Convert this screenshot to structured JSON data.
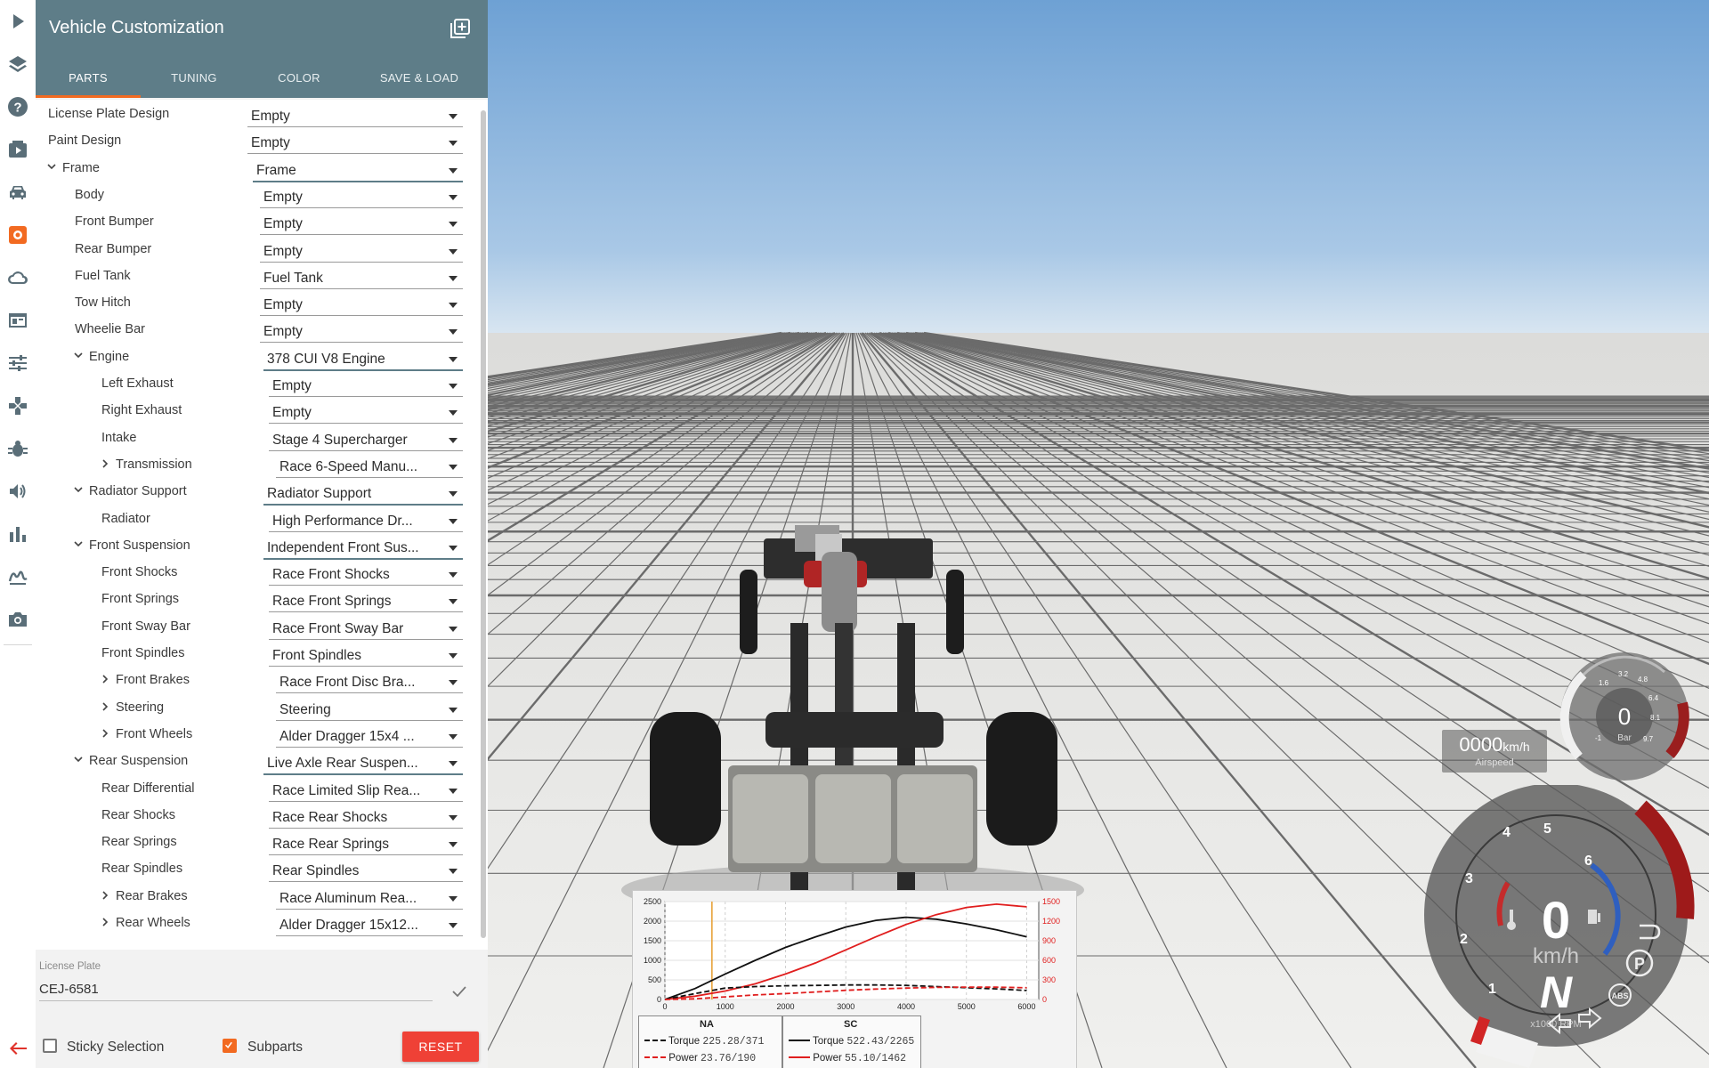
{
  "sidebar": {
    "icons": [
      "play-icon",
      "layers-icon",
      "help-icon",
      "video-icon",
      "car-icon",
      "gear-icon",
      "cloud-icon",
      "window-icon",
      "sliders-icon",
      "gamepad-icon",
      "bug-icon",
      "sound-icon",
      "stats-icon",
      "signature-icon",
      "camera-icon",
      "back-arrow-icon"
    ],
    "active": "gear-icon"
  },
  "panel": {
    "title": "Vehicle Customization",
    "tabs": [
      "PARTS",
      "TUNING",
      "COLOR",
      "SAVE & LOAD"
    ],
    "active_tab": "PARTS"
  },
  "parts": [
    {
      "label": "License Plate Design",
      "value": "Empty",
      "level": 0,
      "chev": ""
    },
    {
      "label": "Paint Design",
      "value": "Empty",
      "level": 0,
      "chev": ""
    },
    {
      "label": "Frame",
      "value": "Frame",
      "level": 0,
      "chev": "down",
      "group": true
    },
    {
      "label": "Body",
      "value": "Empty",
      "level": 1,
      "chev": ""
    },
    {
      "label": "Front Bumper",
      "value": "Empty",
      "level": 1,
      "chev": ""
    },
    {
      "label": "Rear Bumper",
      "value": "Empty",
      "level": 1,
      "chev": ""
    },
    {
      "label": "Fuel Tank",
      "value": "Fuel Tank",
      "level": 1,
      "chev": ""
    },
    {
      "label": "Tow Hitch",
      "value": "Empty",
      "level": 1,
      "chev": ""
    },
    {
      "label": "Wheelie Bar",
      "value": "Empty",
      "level": 1,
      "chev": ""
    },
    {
      "label": "Engine",
      "value": "378 CUI V8 Engine",
      "level": 1,
      "chev": "down",
      "group": true
    },
    {
      "label": "Left Exhaust",
      "value": "Empty",
      "level": 2,
      "chev": ""
    },
    {
      "label": "Right Exhaust",
      "value": "Empty",
      "level": 2,
      "chev": ""
    },
    {
      "label": "Intake",
      "value": "Stage 4 Supercharger",
      "level": 2,
      "chev": ""
    },
    {
      "label": "Transmission",
      "value": "Race 6-Speed Manu...",
      "level": 2,
      "chev": "right"
    },
    {
      "label": "Radiator Support",
      "value": "Radiator Support",
      "level": 1,
      "chev": "down",
      "group": true
    },
    {
      "label": "Radiator",
      "value": "High Performance Dr...",
      "level": 2,
      "chev": ""
    },
    {
      "label": "Front Suspension",
      "value": "Independent Front Sus...",
      "level": 1,
      "chev": "down",
      "group": true
    },
    {
      "label": "Front Shocks",
      "value": "Race Front Shocks",
      "level": 2,
      "chev": ""
    },
    {
      "label": "Front Springs",
      "value": "Race Front Springs",
      "level": 2,
      "chev": ""
    },
    {
      "label": "Front Sway Bar",
      "value": "Race Front Sway Bar",
      "level": 2,
      "chev": ""
    },
    {
      "label": "Front Spindles",
      "value": "Front Spindles",
      "level": 2,
      "chev": ""
    },
    {
      "label": "Front Brakes",
      "value": "Race Front Disc Bra...",
      "level": 2,
      "chev": "right"
    },
    {
      "label": "Steering",
      "value": "Steering",
      "level": 2,
      "chev": "right"
    },
    {
      "label": "Front Wheels",
      "value": "Alder Dragger 15x4 ...",
      "level": 2,
      "chev": "right"
    },
    {
      "label": "Rear Suspension",
      "value": "Live Axle Rear Suspen...",
      "level": 1,
      "chev": "down",
      "group": true
    },
    {
      "label": "Rear Differential",
      "value": "Race Limited Slip Rea...",
      "level": 2,
      "chev": ""
    },
    {
      "label": "Rear Shocks",
      "value": "Race Rear Shocks",
      "level": 2,
      "chev": ""
    },
    {
      "label": "Rear Springs",
      "value": "Race Rear Springs",
      "level": 2,
      "chev": ""
    },
    {
      "label": "Rear Spindles",
      "value": "Rear Spindles",
      "level": 2,
      "chev": ""
    },
    {
      "label": "Rear Brakes",
      "value": "Race Aluminum Rea...",
      "level": 2,
      "chev": "right"
    },
    {
      "label": "Rear Wheels",
      "value": "Alder Dragger 15x12...",
      "level": 2,
      "chev": "right"
    }
  ],
  "license_plate": {
    "label": "License Plate",
    "value": "CEJ-6581"
  },
  "footer": {
    "sticky_label": "Sticky Selection",
    "sticky_checked": false,
    "subparts_label": "Subparts",
    "subparts_checked": true,
    "reset_label": "RESET"
  },
  "colors": {
    "header": "#5e7d88",
    "accent": "#f26a21",
    "reset": "#ef4136"
  },
  "chart_data": {
    "type": "line",
    "x_ticks": [
      "0",
      "1000",
      "2000",
      "3000",
      "4000",
      "5000",
      "6000"
    ],
    "y_left_ticks": [
      "0",
      "500",
      "1000",
      "1500",
      "2000",
      "2500"
    ],
    "y_right_ticks": [
      "0",
      "300",
      "600",
      "900",
      "1200",
      "1500"
    ],
    "xlim": [
      0,
      6200
    ],
    "ylim_left": [
      0,
      2500
    ],
    "ylim_right": [
      0,
      1500
    ],
    "series": [
      {
        "name": "SC Torque",
        "axis": "left",
        "color": "#111111",
        "dash": false,
        "x": [
          0,
          500,
          1000,
          1500,
          2000,
          2500,
          3000,
          3500,
          4000,
          4500,
          5000,
          5500,
          6000
        ],
        "y": [
          0,
          280,
          650,
          1000,
          1330,
          1600,
          1850,
          2020,
          2100,
          2050,
          1930,
          1780,
          1600
        ]
      },
      {
        "name": "SC Power",
        "axis": "right",
        "color": "#e01e1e",
        "dash": false,
        "x": [
          0,
          500,
          1000,
          1500,
          2000,
          2500,
          3000,
          3500,
          4000,
          4500,
          5000,
          5500,
          6000
        ],
        "y": [
          0,
          50,
          130,
          240,
          390,
          560,
          760,
          960,
          1150,
          1300,
          1410,
          1460,
          1420
        ]
      },
      {
        "name": "NA Torque",
        "axis": "left",
        "color": "#111111",
        "dash": true,
        "x": [
          0,
          500,
          1000,
          1500,
          2000,
          2500,
          3000,
          3500,
          4000,
          4500,
          5000,
          5500,
          6000
        ],
        "y": [
          0,
          150,
          290,
          330,
          350,
          360,
          370,
          370,
          360,
          330,
          300,
          270,
          230
        ]
      },
      {
        "name": "NA Power",
        "axis": "right",
        "color": "#e01e1e",
        "dash": true,
        "x": [
          0,
          500,
          1000,
          1500,
          2000,
          2500,
          3000,
          3500,
          4000,
          4500,
          5000,
          5500,
          6000
        ],
        "y": [
          0,
          10,
          40,
          70,
          90,
          115,
          140,
          160,
          175,
          185,
          190,
          188,
          180
        ]
      }
    ],
    "marker_rpm": 780,
    "legend": {
      "na_title": "NA",
      "na_torque_label": "Torque",
      "na_torque_val": "225.28/371",
      "na_power_label": "Power",
      "na_power_val": "23.76/190",
      "sc_title": "SC",
      "sc_torque_label": "Torque",
      "sc_torque_val": "522.43/2265",
      "sc_power_label": "Power",
      "sc_power_val": "55.10/1462"
    }
  },
  "hud": {
    "airspeed_value": "0000",
    "airspeed_unit": "km/h",
    "airspeed_label": "Airspeed",
    "boost_value": "0",
    "boost_unit": "Bar",
    "boost_ticks": [
      "1.6",
      "3.2",
      "4.8",
      "6.4",
      "8.1",
      "9.7",
      "-1"
    ],
    "speed_value": "0",
    "speed_unit": "km/h",
    "gear": "N",
    "rpm_unit": "x1000 RPM",
    "rpm_ticks": [
      "1",
      "2",
      "3",
      "4",
      "5",
      "6"
    ],
    "park": "P",
    "abs": "ABS"
  }
}
